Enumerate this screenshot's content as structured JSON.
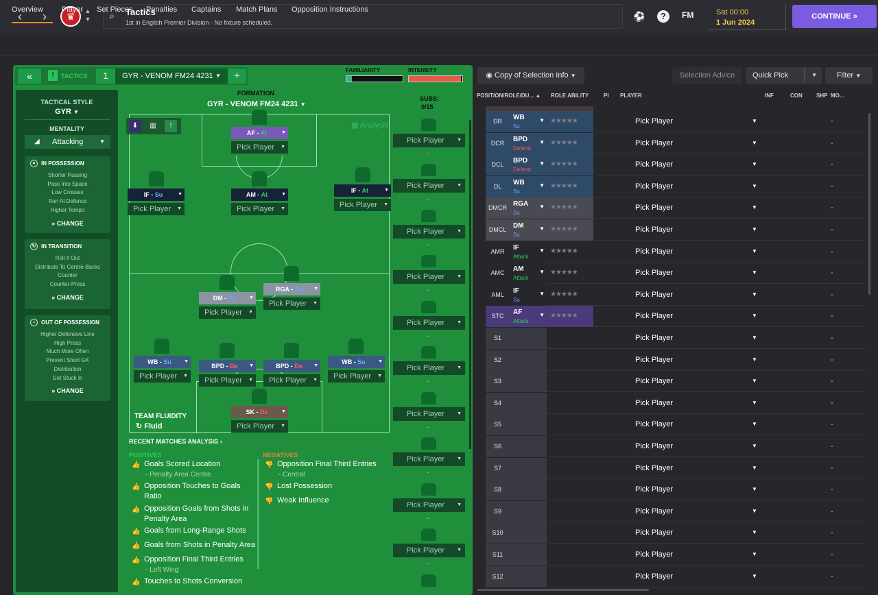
{
  "header": {
    "title": "Tactics",
    "subtitle": "1st in English Premier Division - No fixture scheduled.",
    "day_time": "Sat 00:00",
    "date": "1 Jun 2024",
    "continue_label": "CONTINUE",
    "fm_label": "FM",
    "help_label": "?"
  },
  "tabs": [
    "Overview",
    "Player",
    "Set Pieces",
    "Penalties",
    "Captains",
    "Match Plans",
    "Opposition Instructions"
  ],
  "tactic": {
    "section_label": "TACTICS",
    "slot_number": "1",
    "name": "GYR - VENOM FM24 4231",
    "familiarity_label": "FAMILIARITY",
    "intensity_label": "INTENSITY",
    "familiarity": 0.1,
    "intensity": 0.95
  },
  "sidebar": {
    "style_label": "TACTICAL STYLE",
    "style_value": "GYR",
    "mentality_label": "MENTALITY",
    "mentality_value": "Attacking",
    "in_possession": {
      "title": "IN POSSESSION",
      "items": [
        "Shorter Passing",
        "Pass Into Space",
        "Low Crosses",
        "Run At Defence",
        "Higher Tempo"
      ],
      "change": "CHANGE"
    },
    "in_transition": {
      "title": "IN TRANSITION",
      "items": [
        "Roll It Out",
        "Distribute To Centre-Backs",
        "Counter",
        "Counter-Press"
      ],
      "change": "CHANGE"
    },
    "out_of_possession": {
      "title": "OUT OF POSSESSION",
      "items": [
        "Higher Defensive Line",
        "High Press",
        "Much More Often",
        "Prevent Short GK",
        "Distribution",
        "Get Stuck In"
      ],
      "change": "CHANGE"
    }
  },
  "formation": {
    "label": "FORMATION",
    "name": "GYR - VENOM FM24 4231",
    "analysis_label": "Analysis",
    "fluidity_label": "TEAM FLUIDITY",
    "fluidity_value": "Fluid",
    "players": [
      {
        "role": "AF",
        "duty": "At",
        "pick": "Pick Player"
      },
      {
        "role": "IF",
        "duty": "Su",
        "pick": "Pick Player"
      },
      {
        "role": "AM",
        "duty": "At",
        "pick": "Pick Player"
      },
      {
        "role": "IF",
        "duty": "At",
        "pick": "Pick Player"
      },
      {
        "role": "DM",
        "duty": "Su",
        "pick": "Pick Player"
      },
      {
        "role": "RGA",
        "duty": "Su",
        "pick": "Pick Player"
      },
      {
        "role": "WB",
        "duty": "Su",
        "pick": "Pick Player"
      },
      {
        "role": "BPD",
        "duty": "De",
        "pick": "Pick Player"
      },
      {
        "role": "BPD",
        "duty": "De",
        "pick": "Pick Player"
      },
      {
        "role": "WB",
        "duty": "Su",
        "pick": "Pick Player"
      },
      {
        "role": "SK",
        "duty": "De",
        "pick": "Pick Player"
      }
    ]
  },
  "subs": {
    "label": "SUBS:",
    "count": "0/15",
    "slot_label": "Pick Player",
    "dash": "-"
  },
  "analysis": {
    "title": "RECENT MATCHES ANALYSIS",
    "positives_label": "POSITIVES",
    "negatives_label": "NEGATIVES",
    "positives": [
      {
        "text": "Goals Scored Location",
        "sub": "- Penalty Area Centre"
      },
      {
        "text": "Opposition Touches to Goals Ratio",
        "sub": ""
      },
      {
        "text": "Opposition Goals from Shots in Penalty Area",
        "sub": ""
      },
      {
        "text": "Goals from Long-Range Shots",
        "sub": ""
      },
      {
        "text": "Goals from Shots in Penalty Area",
        "sub": ""
      },
      {
        "text": "Opposition Final Third Entries",
        "sub": "- Left Wing"
      },
      {
        "text": "Touches to Shots Conversion",
        "sub": ""
      }
    ],
    "negatives": [
      {
        "text": "Opposition Final Third Entries",
        "sub": "- Central"
      },
      {
        "text": "Lost Possession",
        "sub": ""
      },
      {
        "text": "Weak Influence",
        "sub": ""
      }
    ]
  },
  "selection": {
    "copy_label": "Copy of Selection Info",
    "advice_label": "Selection Advice",
    "quick_pick_label": "Quick Pick",
    "filter_label": "Filter",
    "columns": [
      "POSITION/ROLE/DU...",
      "ROLE ABILITY",
      "PI",
      "PLAYER",
      "INF",
      "CON",
      "SHP",
      "MO..."
    ],
    "pick_label": "Pick Player",
    "dash": "-",
    "rows": [
      {
        "pos": "DR",
        "role": "WB",
        "duty": "Su"
      },
      {
        "pos": "DCR",
        "role": "BPD",
        "duty": "Defend"
      },
      {
        "pos": "DCL",
        "role": "BPD",
        "duty": "Defend"
      },
      {
        "pos": "DL",
        "role": "WB",
        "duty": "Su"
      },
      {
        "pos": "DMCR",
        "role": "RGA",
        "duty": "Su"
      },
      {
        "pos": "DMCL",
        "role": "DM",
        "duty": "Su"
      },
      {
        "pos": "AMR",
        "role": "IF",
        "duty": "Attack"
      },
      {
        "pos": "AMC",
        "role": "AM",
        "duty": "Attack"
      },
      {
        "pos": "AML",
        "role": "IF",
        "duty": "Su"
      },
      {
        "pos": "STC",
        "role": "AF",
        "duty": "Attack"
      },
      {
        "pos": "S1"
      },
      {
        "pos": "S2"
      },
      {
        "pos": "S3"
      },
      {
        "pos": "S4"
      },
      {
        "pos": "S5"
      },
      {
        "pos": "S6"
      },
      {
        "pos": "S7"
      },
      {
        "pos": "S8"
      },
      {
        "pos": "S9"
      },
      {
        "pos": "S10"
      },
      {
        "pos": "S11"
      },
      {
        "pos": "S12"
      }
    ]
  },
  "colors": {
    "accent": "#7b5ce0",
    "pitch": "#1f8f3c",
    "attack": "#2bd15e",
    "support": "#6aa6ff",
    "defend": "#ff5b5b"
  }
}
